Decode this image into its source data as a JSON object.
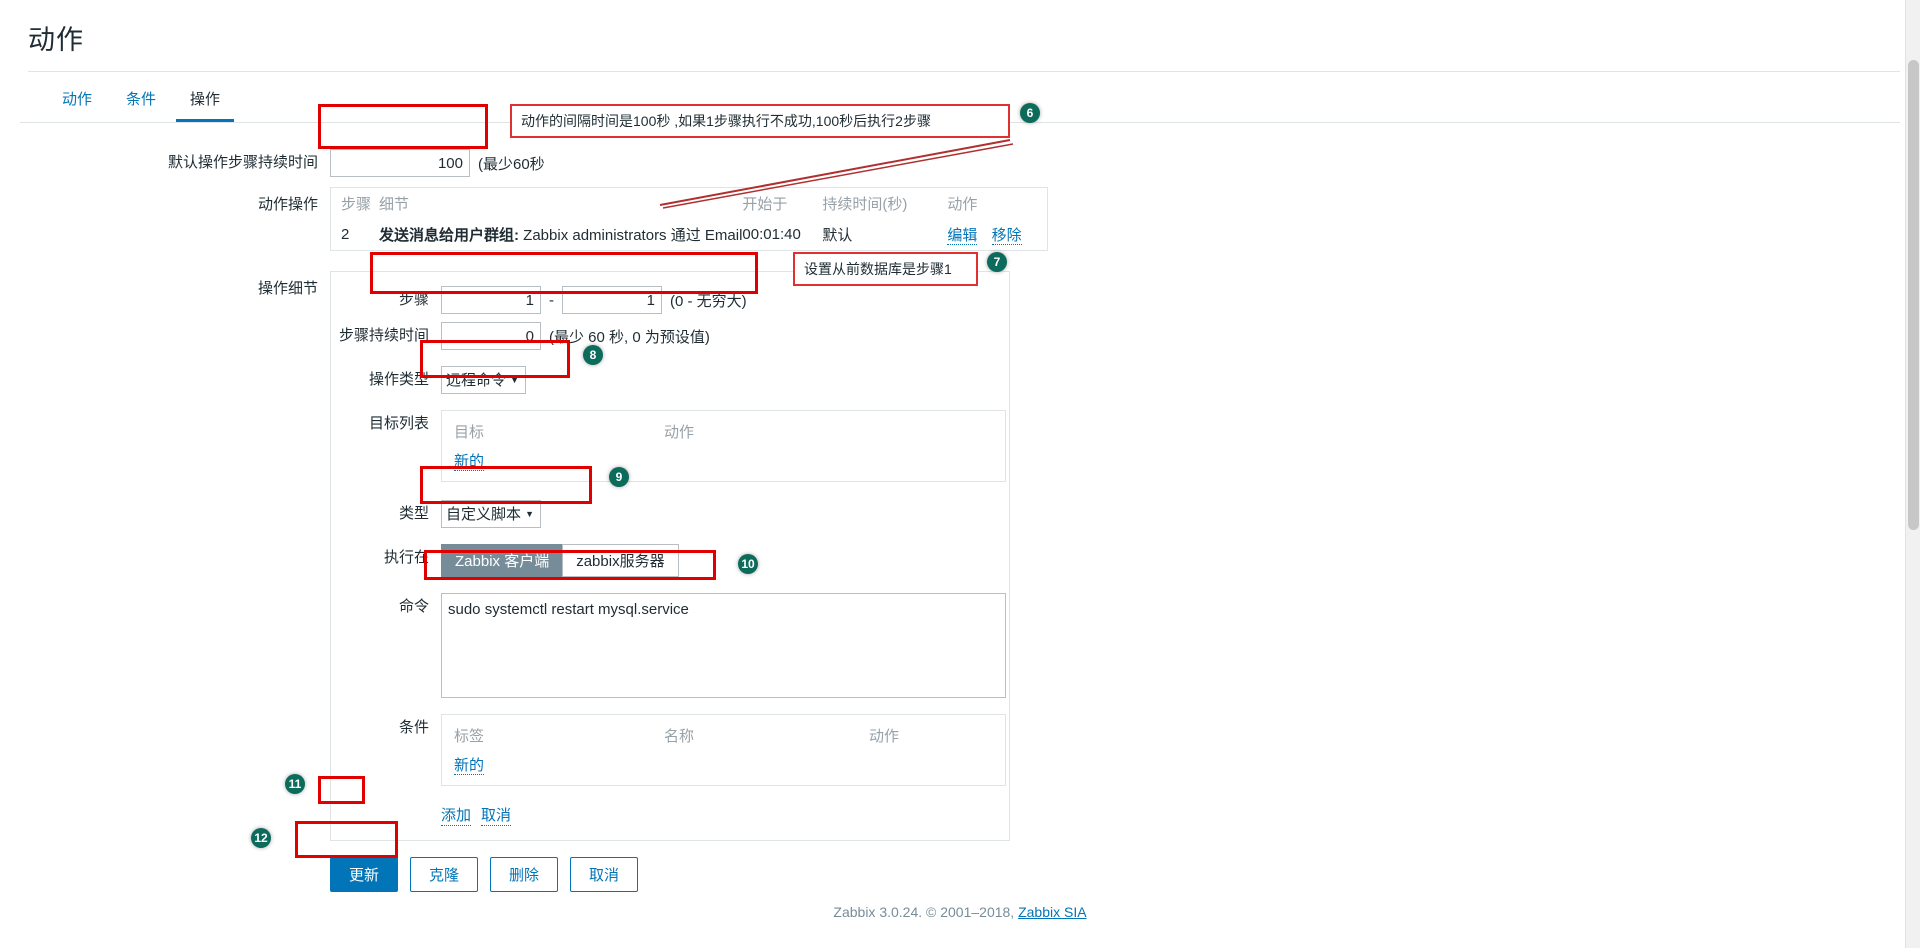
{
  "page": {
    "title": "动作"
  },
  "tabs": [
    {
      "label": "动作",
      "active": false
    },
    {
      "label": "条件",
      "active": false
    },
    {
      "label": "操作",
      "active": true
    }
  ],
  "default_step_duration": {
    "label": "默认操作步骤持续时间",
    "value": "100",
    "hint": "(最少60秒"
  },
  "action_operations": {
    "label": "动作操作",
    "columns": {
      "step": "步骤",
      "details": "细节",
      "start_in": "开始于",
      "duration": "持续时间(秒)",
      "action": "动作"
    },
    "rows": [
      {
        "step": "2",
        "detail_bold": "发送消息给用户群组:",
        "detail_rest": "Zabbix administrators 通过 Email",
        "start_in": "00:01:40",
        "duration": "默认",
        "edit": "编辑",
        "remove": "移除"
      }
    ]
  },
  "operation_details": {
    "label": "操作细节",
    "steps": {
      "label": "步骤",
      "from": "1",
      "to": "1",
      "separator": "-",
      "hint": "(0 - 无穷大)"
    },
    "step_duration": {
      "label": "步骤持续时间",
      "value": "0",
      "hint": "(最少 60 秒, 0 为预设值)"
    },
    "operation_type": {
      "label": "操作类型",
      "value": "远程命令"
    },
    "target_list": {
      "label": "目标列表",
      "col_target": "目标",
      "col_action": "动作",
      "new_link": "新的"
    },
    "type": {
      "label": "类型",
      "value": "自定义脚本"
    },
    "execute_on": {
      "label": "执行在",
      "options": [
        {
          "label": "Zabbix 客户端",
          "selected": true
        },
        {
          "label": "zabbix服务器",
          "selected": false
        }
      ]
    },
    "commands": {
      "label": "命令",
      "value": "sudo systemctl restart mysql.service"
    },
    "conditions": {
      "label": "条件",
      "col_label": "标签",
      "col_name": "名称",
      "col_action": "动作",
      "new_link": "新的"
    },
    "add_link": "添加",
    "cancel_link": "取消"
  },
  "footer_buttons": {
    "update": "更新",
    "clone": "克隆",
    "delete": "删除",
    "cancel": "取消"
  },
  "footer": {
    "text": "Zabbix 3.0.24. © 2001–2018,",
    "link": "Zabbix SIA"
  },
  "annotations": {
    "callout6": "动作的间隔时间是100秒 ,如果1步骤执行不成功,100秒后执行2步骤",
    "callout7": "设置从前数据库是步骤1",
    "badges": {
      "b6": "6",
      "b7": "7",
      "b8": "8",
      "b9": "9",
      "b10": "10",
      "b11": "11",
      "b12": "12"
    }
  },
  "colors": {
    "accent": "#0275b8",
    "highlight": "#e00000",
    "badge": "#0d6b5c",
    "segment_on": "#768d99"
  }
}
